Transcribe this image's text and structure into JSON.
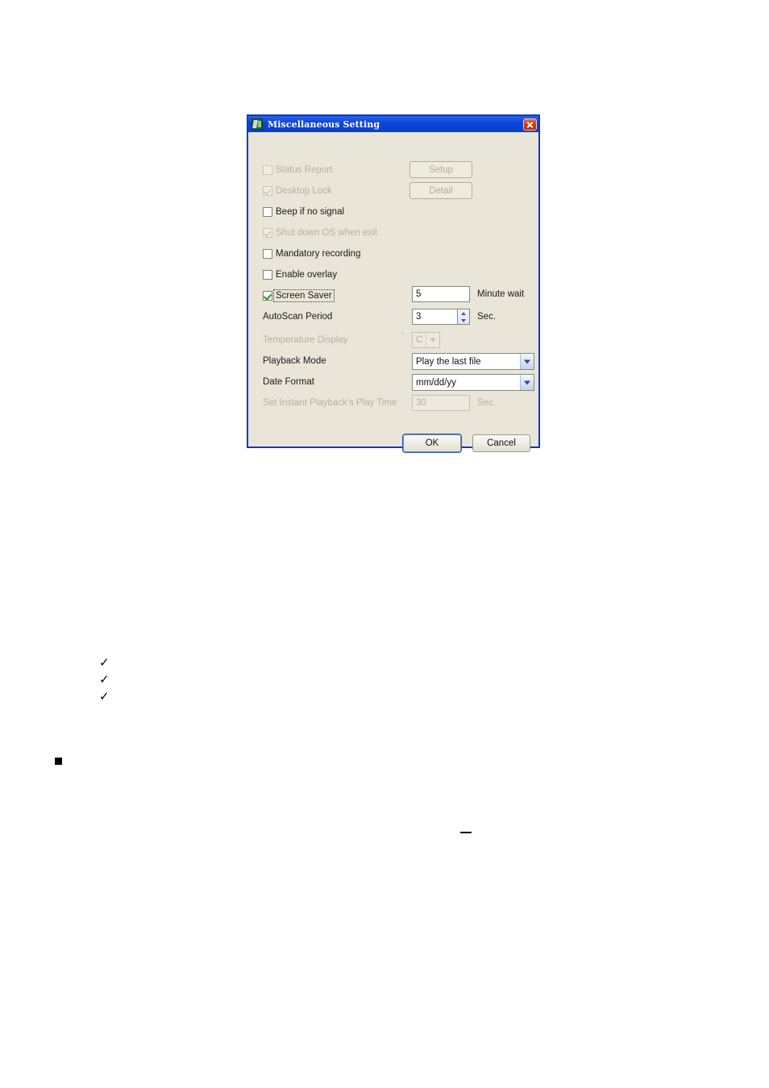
{
  "dialog": {
    "title": "Miscellaneous Setting",
    "title_icon": "app-icon",
    "close_icon": "close-icon",
    "accent_titlebar_color": "#0a45d6",
    "body_color": "#e9e5d8",
    "close_button_color": "#d33b1c",
    "check_color": "#1d9a2a",
    "checkboxes": [
      {
        "label": "Status Report",
        "checked": false,
        "enabled": false,
        "focused": false
      },
      {
        "label": "Desktop Lock",
        "checked": true,
        "enabled": false,
        "focused": false
      },
      {
        "label": "Beep if no signal",
        "checked": false,
        "enabled": true,
        "focused": false
      },
      {
        "label": "Shut down OS when exit",
        "checked": true,
        "enabled": false,
        "focused": false
      },
      {
        "label": "Mandatory recording",
        "checked": false,
        "enabled": true,
        "focused": false
      },
      {
        "label": "Enable overlay",
        "checked": false,
        "enabled": true,
        "focused": false
      },
      {
        "label": "Screen Saver",
        "checked": true,
        "enabled": true,
        "focused": true
      }
    ],
    "side_buttons": [
      {
        "label": "Setup",
        "enabled": false
      },
      {
        "label": "Detail",
        "enabled": false
      }
    ],
    "fields": {
      "screen_saver": {
        "value": "5",
        "unit": "Minute wait",
        "enabled": true
      },
      "autoscan": {
        "label": "AutoScan Period",
        "value": "3",
        "unit": "Sec.",
        "enabled": true
      },
      "temperature": {
        "label": "Temperature Display",
        "value": "C",
        "degree": "°",
        "enabled": false
      },
      "playback_mode": {
        "label": "Playback Mode",
        "value": "Play the last file",
        "enabled": true
      },
      "date_format": {
        "label": "Date Format",
        "value": "mm/dd/yy",
        "enabled": true
      },
      "instant_playback": {
        "label": "Set Instant Playback's Play Time",
        "value": "30",
        "unit": "Sec.",
        "enabled": false
      }
    },
    "actions": {
      "ok_label": "OK",
      "cancel_label": "Cancel"
    }
  },
  "page_marks": {
    "checkmark": "✓",
    "checkmark_count": 3,
    "square_bullet": "■",
    "dash": "–"
  }
}
